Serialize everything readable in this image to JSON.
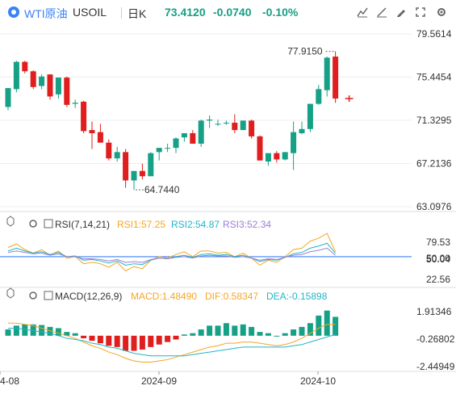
{
  "header": {
    "title": "WTI原油",
    "symbol": "USOIL",
    "period": "日K",
    "price": "73.4120",
    "change": "-0.0740",
    "change_pct": "-0.10%"
  },
  "toolbar_icons": [
    "indicator-icon",
    "draw-icon",
    "pen-icon",
    "fullscreen-icon",
    "settings-icon"
  ],
  "colors": {
    "up": "#16a085",
    "down": "#e01e1e",
    "accent": "#3b82f6"
  },
  "chart_data": [
    {
      "type": "candlestick",
      "y_axis_labels": [
        "79.5614",
        "75.4454",
        "71.3295",
        "67.2136",
        "63.0976"
      ],
      "ylim": [
        63.0976,
        79.5614
      ],
      "max_label": "77.9150",
      "min_label": "64.7440",
      "x_tick_labels": [
        "4-08",
        "2024-09",
        "2024-10"
      ],
      "candles": [
        [
          72.6,
          74.4,
          72.3,
          74.4
        ],
        [
          74.3,
          77.0,
          74.0,
          76.9
        ],
        [
          76.9,
          77.0,
          75.8,
          76.0
        ],
        [
          76.0,
          76.1,
          74.3,
          74.5
        ],
        [
          74.6,
          75.7,
          74.3,
          75.5
        ],
        [
          75.7,
          75.7,
          73.3,
          73.6
        ],
        [
          73.8,
          75.4,
          73.4,
          75.4
        ],
        [
          75.4,
          75.5,
          72.6,
          72.8
        ],
        [
          72.9,
          73.3,
          72.5,
          73.0
        ],
        [
          73.1,
          73.2,
          70.1,
          70.3
        ],
        [
          70.4,
          71.2,
          68.6,
          70.1
        ],
        [
          70.2,
          71.0,
          69.5,
          69.2
        ],
        [
          69.2,
          69.5,
          67.5,
          67.7
        ],
        [
          67.7,
          68.8,
          67.4,
          68.3
        ],
        [
          68.3,
          68.6,
          64.9,
          65.6
        ],
        [
          65.6,
          65.9,
          64.7,
          66.5
        ],
        [
          66.5,
          67.2,
          65.7,
          66.0
        ],
        [
          66.0,
          68.3,
          66.0,
          68.2
        ],
        [
          68.3,
          68.7,
          67.5,
          68.7
        ],
        [
          68.7,
          69.1,
          68.3,
          68.7
        ],
        [
          68.7,
          69.7,
          68.2,
          69.6
        ],
        [
          69.7,
          70.1,
          69.3,
          70.1
        ],
        [
          70.1,
          70.4,
          69.1,
          69.1
        ],
        [
          69.1,
          71.4,
          68.8,
          71.3
        ],
        [
          71.3,
          71.8,
          70.6,
          71.4
        ],
        [
          71.0,
          71.4,
          70.8,
          71.0
        ],
        [
          71.1,
          71.3,
          70.9,
          71.1
        ],
        [
          71.1,
          71.9,
          70.1,
          70.4
        ],
        [
          70.4,
          71.3,
          70.4,
          71.3
        ],
        [
          71.3,
          71.4,
          69.6,
          69.8
        ],
        [
          69.8,
          69.9,
          67.5,
          67.5
        ],
        [
          67.4,
          67.6,
          67.0,
          68.2
        ],
        [
          68.2,
          68.4,
          67.3,
          67.6
        ],
        [
          67.6,
          68.3,
          67.5,
          68.3
        ],
        [
          68.2,
          71.2,
          66.6,
          70.2
        ],
        [
          70.1,
          71.2,
          70.0,
          70.5
        ],
        [
          70.5,
          72.3,
          70.2,
          72.9
        ],
        [
          72.9,
          74.7,
          72.8,
          74.3
        ],
        [
          74.2,
          77.4,
          73.6,
          77.3
        ],
        [
          77.4,
          77.9,
          73.0,
          73.4
        ]
      ]
    },
    {
      "type": "line",
      "indicator": "RSI(7,14,21)",
      "legend": [
        "RSI1:57.25",
        "RSI2:54.87",
        "RSI3:52.34"
      ],
      "series_colors": [
        "#f5a623",
        "#21b5c8",
        "#9b7fd4"
      ],
      "y_axis_labels": [
        "79.53",
        "50.00",
        "50.04",
        "22.56"
      ],
      "ylim": [
        22.56,
        79.53
      ],
      "series": [
        {
          "name": "RSI1",
          "values": [
            63,
            68,
            60,
            55,
            60,
            52,
            58,
            48,
            50,
            40,
            42,
            40,
            35,
            42,
            30,
            36,
            33,
            45,
            50,
            48,
            53,
            57,
            50,
            58,
            58,
            55,
            56,
            50,
            55,
            48,
            38,
            45,
            42,
            50,
            60,
            62,
            72,
            76,
            83,
            57
          ]
        },
        {
          "name": "RSI2",
          "values": [
            58,
            62,
            58,
            55,
            57,
            53,
            56,
            50,
            51,
            45,
            46,
            44,
            41,
            44,
            38,
            40,
            39,
            45,
            48,
            47,
            50,
            52,
            49,
            53,
            54,
            52,
            53,
            50,
            52,
            48,
            43,
            46,
            45,
            49,
            54,
            56,
            62,
            65,
            69,
            55
          ]
        },
        {
          "name": "RSI3",
          "values": [
            56,
            58,
            56,
            54,
            55,
            52,
            54,
            50,
            50,
            47,
            47,
            46,
            44,
            46,
            42,
            43,
            42,
            46,
            48,
            47,
            49,
            50,
            48,
            51,
            52,
            51,
            51,
            49,
            50,
            48,
            45,
            47,
            46,
            49,
            52,
            53,
            57,
            59,
            62,
            52
          ]
        }
      ]
    },
    {
      "type": "bar+line",
      "indicator": "MACD(12,26,9)",
      "legend": [
        "MACD:1.48490",
        "DIF:0.58347",
        "DEA:-0.15898"
      ],
      "series_colors": [
        "#f5a623",
        "#f5a623",
        "#21b5c8"
      ],
      "y_axis_labels": [
        "1.91346",
        "-0.26802",
        "-2.44949"
      ],
      "ylim": [
        -2.44949,
        1.91346
      ],
      "macd_bars": [
        0.5,
        0.8,
        0.9,
        0.9,
        0.85,
        0.7,
        0.6,
        0.3,
        0.2,
        -0.2,
        -0.4,
        -0.6,
        -0.8,
        -0.9,
        -1.2,
        -1.2,
        -1.1,
        -0.9,
        -0.7,
        -0.5,
        -0.3,
        0.1,
        0.2,
        0.5,
        0.8,
        0.8,
        1.0,
        0.8,
        0.9,
        0.7,
        0.3,
        0.2,
        0.0,
        0.2,
        0.5,
        0.7,
        1.0,
        1.6,
        2.0,
        1.5
      ],
      "dif": [
        1.0,
        1.0,
        0.9,
        0.8,
        0.6,
        0.4,
        0.2,
        0.0,
        -0.2,
        -0.5,
        -0.8,
        -1.0,
        -1.3,
        -1.5,
        -1.8,
        -2.0,
        -2.1,
        -2.1,
        -2.0,
        -1.9,
        -1.7,
        -1.5,
        -1.3,
        -1.1,
        -0.9,
        -0.8,
        -0.6,
        -0.6,
        -0.5,
        -0.5,
        -0.6,
        -0.7,
        -0.8,
        -0.7,
        -0.5,
        -0.2,
        0.2,
        0.6,
        0.9,
        0.9
      ],
      "dea": [
        0.6,
        0.6,
        0.5,
        0.4,
        0.3,
        0.2,
        0.0,
        -0.2,
        -0.3,
        -0.4,
        -0.6,
        -0.7,
        -0.9,
        -1.0,
        -1.2,
        -1.4,
        -1.5,
        -1.6,
        -1.6,
        -1.6,
        -1.6,
        -1.6,
        -1.5,
        -1.4,
        -1.3,
        -1.2,
        -1.1,
        -1.0,
        -0.9,
        -0.9,
        -0.9,
        -0.9,
        -0.9,
        -0.9,
        -0.8,
        -0.7,
        -0.5,
        -0.3,
        -0.1,
        0.1
      ]
    }
  ]
}
